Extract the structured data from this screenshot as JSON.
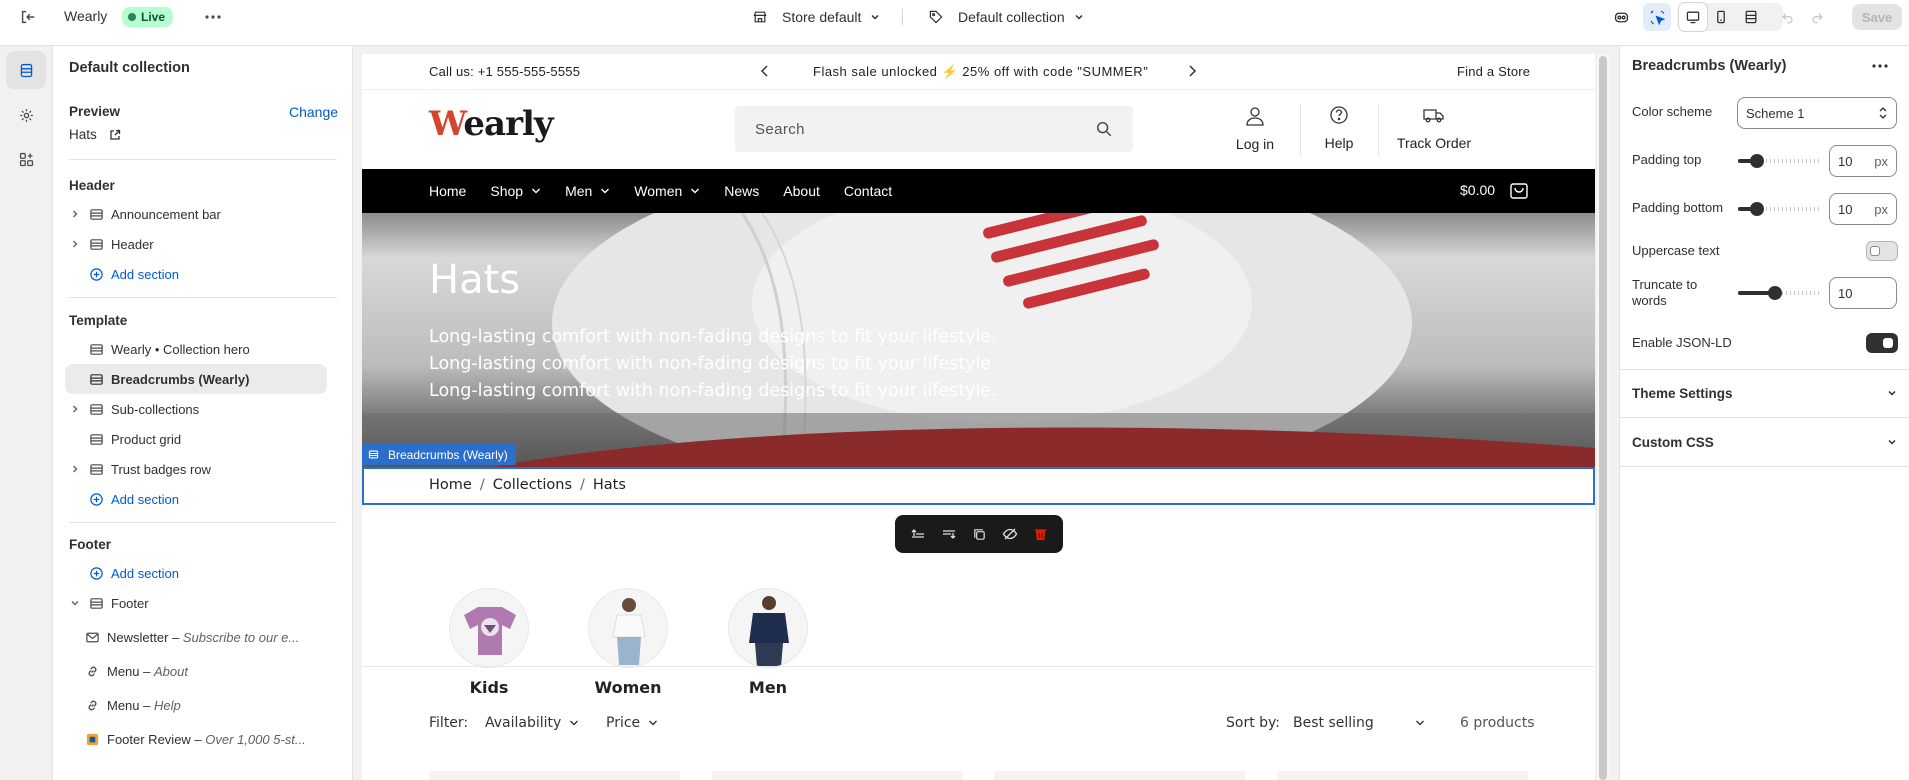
{
  "topbar": {
    "app_name": "Wearly",
    "live_badge": "Live",
    "store_select": "Store default",
    "template_select": "Default collection",
    "save_label": "Save"
  },
  "left": {
    "title": "Default collection",
    "preview_label": "Preview",
    "change_label": "Change",
    "preview_value": "Hats",
    "header_title": "Header",
    "header_items": [
      "Announcement bar",
      "Header"
    ],
    "add_section": "Add section",
    "template_title": "Template",
    "template_items": [
      "Wearly • Collection hero",
      "Breadcrumbs (Wearly)",
      "Sub-collections",
      "Product grid",
      "Trust badges row"
    ],
    "footer_title": "Footer",
    "footer_group": "Footer",
    "footer_blocks": [
      {
        "name": "Newsletter",
        "sub": "Subscribe to our e..."
      },
      {
        "name": "Menu",
        "sub": "About"
      },
      {
        "name": "Menu",
        "sub": "Help"
      },
      {
        "name": "Footer Review",
        "sub": "Over 1,000 5-st..."
      }
    ]
  },
  "preview": {
    "announcement_left": "Call us: +1 555-555-5555",
    "announcement_center": "Flash sale unlocked ⚡ 25% off with code \"SUMMER\"",
    "announcement_right": "Find a Store",
    "logo_w": "W",
    "logo_rest": "early",
    "search_placeholder": "Search",
    "header_links": [
      "Log in",
      "Help",
      "Track Order"
    ],
    "nav": [
      "Home",
      "Shop",
      "Men",
      "Women",
      "News",
      "About",
      "Contact"
    ],
    "cart_total": "$0.00",
    "hero_title": "Hats",
    "hero_lines": [
      "Long-lasting comfort with non-fading designs to fit your lifestyle.",
      "Long-lasting comfort with non-fading designs to fit your lifestyle.",
      "Long-lasting comfort with non-fading designs to fit your lifestyle."
    ],
    "selected_tag": "Breadcrumbs (Wearly)",
    "breadcrumbs": [
      "Home",
      "Collections",
      "Hats"
    ],
    "breadcrumb_sep": "/",
    "collections": [
      "Kids",
      "Women",
      "Men"
    ],
    "filter_label": "Filter:",
    "filter_availability": "Availability",
    "filter_price": "Price",
    "sort_label": "Sort by:",
    "sort_value": "Best selling",
    "product_count": "6 products"
  },
  "right": {
    "title": "Breadcrumbs (Wearly)",
    "color_scheme_label": "Color scheme",
    "color_scheme_value": "Scheme 1",
    "padding_top_label": "Padding top",
    "padding_top_value": "10",
    "padding_bottom_label": "Padding bottom",
    "padding_bottom_value": "10",
    "unit_px": "px",
    "uppercase_label": "Uppercase text",
    "truncate_label_1": "Truncate to",
    "truncate_label_2": "words",
    "truncate_value": "10",
    "jsonld_label": "Enable JSON-LD",
    "theme_settings": "Theme Settings",
    "custom_css": "Custom CSS"
  },
  "colors": {
    "accent_blue": "#005bd3",
    "live_green": "#b4fed2",
    "selection_blue": "#2c6ecb",
    "logo_red": "#d6452b",
    "nav_black": "#000000",
    "delete_red": "#e51c00"
  }
}
